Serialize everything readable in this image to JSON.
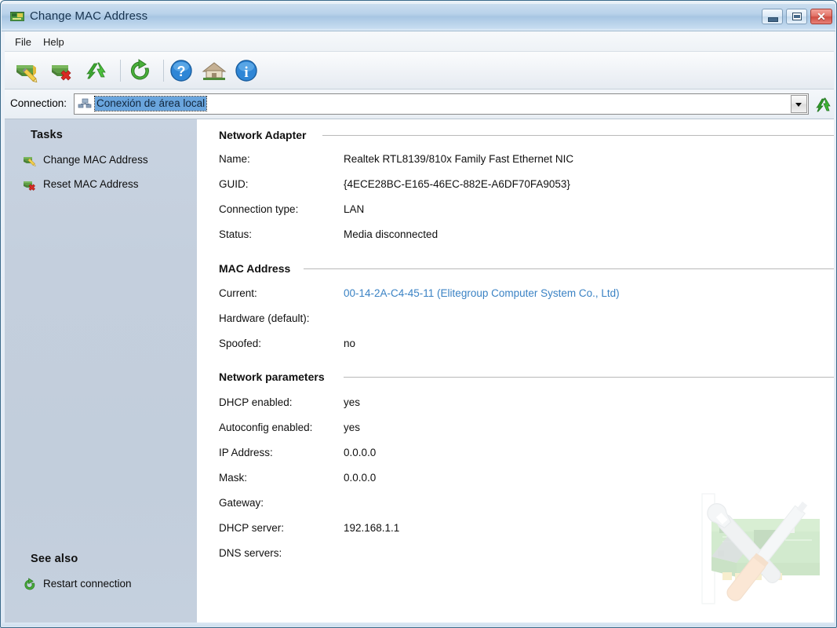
{
  "window": {
    "title": "Change MAC Address",
    "app_icon": "network-card-icon",
    "controls": {
      "minimize_label": "",
      "maximize_label": "",
      "close_label": "✕"
    }
  },
  "menu": {
    "items": [
      {
        "label": "File",
        "name": "menu-file"
      },
      {
        "label": "Help",
        "name": "menu-help"
      }
    ]
  },
  "toolbar": {
    "buttons": [
      {
        "name": "change-mac-address-button",
        "icon": "network-card-pencil-icon",
        "title": "Change MAC Address"
      },
      {
        "name": "reset-mac-address-button",
        "icon": "network-card-red-x-icon",
        "title": "Reset MAC Address"
      },
      {
        "name": "refresh-button",
        "icon": "green-double-arrow-refresh-icon",
        "title": "Refresh"
      },
      {
        "name": "restart-connection-button",
        "icon": "green-circular-restart-icon",
        "title": "Restart connection"
      },
      {
        "name": "help-button",
        "icon": "blue-question-mark-help-icon",
        "title": "Help"
      },
      {
        "name": "home-button",
        "icon": "house-home-icon",
        "title": "Home"
      },
      {
        "name": "about-button",
        "icon": "blue-info-icon",
        "title": "About"
      }
    ]
  },
  "connection_bar": {
    "label": "Connection:",
    "selected": "Conexión de área local",
    "icon": "network-connection-icon",
    "dropdown_icon": "chevron-down-icon",
    "refresh_icon": "green-double-arrow-refresh-icon",
    "options": [
      "Conexión de área local"
    ]
  },
  "sidebar": {
    "tasks_heading": "Tasks",
    "tasks": [
      {
        "label": "Change MAC Address",
        "icon": "network-card-pencil-icon",
        "name": "sidebar-item-change-mac-address"
      },
      {
        "label": "Reset MAC Address",
        "icon": "network-card-red-x-icon",
        "name": "sidebar-item-reset-mac-address"
      }
    ],
    "see_also_heading": "See also",
    "see_also": [
      {
        "label": "Restart connection",
        "icon": "green-circular-restart-icon",
        "name": "sidebar-item-restart-connection"
      }
    ]
  },
  "main": {
    "sections": [
      {
        "title": "Network Adapter",
        "rows": [
          {
            "label": "Name:",
            "value": "Realtek RTL8139/810x Family Fast Ethernet NIC",
            "is_link": false
          },
          {
            "label": "GUID:",
            "value": "{4ECE28BC-E165-46EC-882E-A6DF70FA9053}",
            "is_link": false
          },
          {
            "label": "Connection type:",
            "value": "LAN",
            "is_link": false
          },
          {
            "label": "Status:",
            "value": "Media disconnected",
            "is_link": false
          }
        ]
      },
      {
        "title": "MAC Address",
        "rows": [
          {
            "label": "Current:",
            "value": "00-14-2A-C4-45-11 (Elitegroup Computer System Co., Ltd)",
            "is_link": true
          },
          {
            "label": "Hardware (default):",
            "value": "",
            "is_link": false
          },
          {
            "label": "Spoofed:",
            "value": "no",
            "is_link": false
          }
        ]
      },
      {
        "title": "Network parameters",
        "rows": [
          {
            "label": "DHCP enabled:",
            "value": "yes",
            "is_link": false
          },
          {
            "label": "Autoconfig enabled:",
            "value": "yes",
            "is_link": false
          },
          {
            "label": "IP Address:",
            "value": "0.0.0.0",
            "is_link": false
          },
          {
            "label": "Mask:",
            "value": "0.0.0.0",
            "is_link": false
          },
          {
            "label": "Gateway:",
            "value": "",
            "is_link": false
          },
          {
            "label": "DHCP server:",
            "value": "192.168.1.1",
            "is_link": false
          },
          {
            "label": "DNS servers:",
            "value": "",
            "is_link": false
          }
        ]
      }
    ],
    "watermark_icon": "network-card-with-tools-watermark"
  },
  "colors": {
    "title_accent": "#a8c6e3",
    "sidebar": "#c3cedd",
    "link": "#3a82c4",
    "selection": "#6aa5dd",
    "close_button": "#cf4d42"
  }
}
